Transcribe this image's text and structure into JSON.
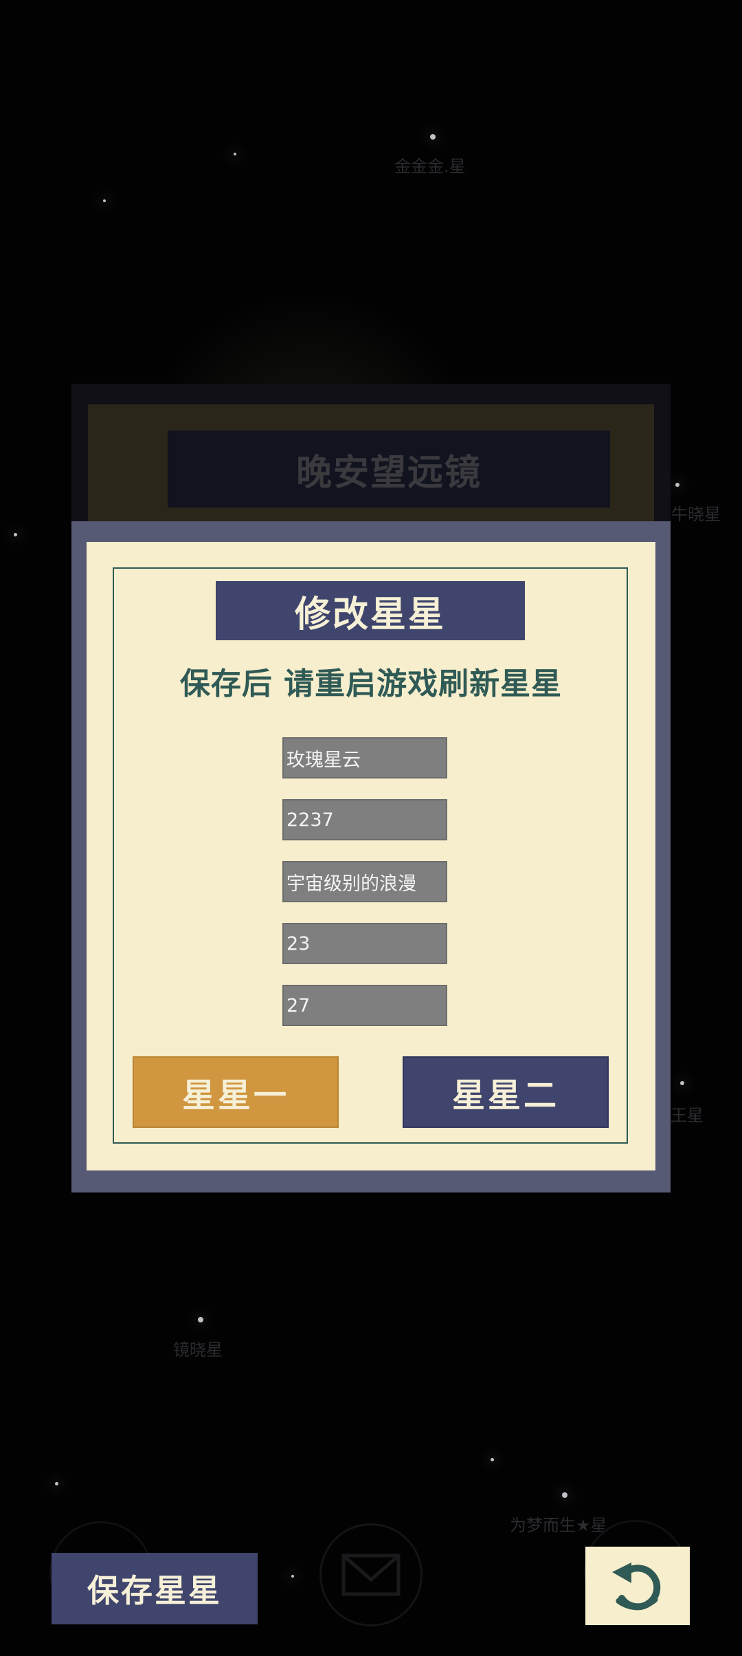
{
  "background": {
    "star_labels": [
      {
        "id": "top-star",
        "text": "金金金.星"
      },
      {
        "id": "right-star",
        "text": "牛晓星"
      },
      {
        "id": "right-mid-star",
        "text": "王星"
      },
      {
        "id": "left-lower-star",
        "text": "镜晓星"
      },
      {
        "id": "bottom-right-star",
        "text": "为梦而生★星"
      }
    ]
  },
  "telescope_panel": {
    "title": "晚安望远镜"
  },
  "modal": {
    "title": "修改星星",
    "hint": "保存后 请重启游戏刷新星星",
    "fields": [
      {
        "value": "玫瑰星云"
      },
      {
        "value": "2237"
      },
      {
        "value": "宇宙级别的浪漫"
      },
      {
        "value": "23"
      },
      {
        "value": "27"
      }
    ],
    "star_one_label": "星星一",
    "star_two_label": "星星二"
  },
  "bottom_bar": {
    "save_label": "保存星星",
    "mail_icon": "envelope-icon",
    "back_icon": "undo-icon"
  },
  "colors": {
    "panel_bg": "#f7eecd",
    "frame": "#575a75",
    "navy": "#3f456c",
    "accent_orange": "#d09640",
    "teal_text": "#2f5a55"
  }
}
